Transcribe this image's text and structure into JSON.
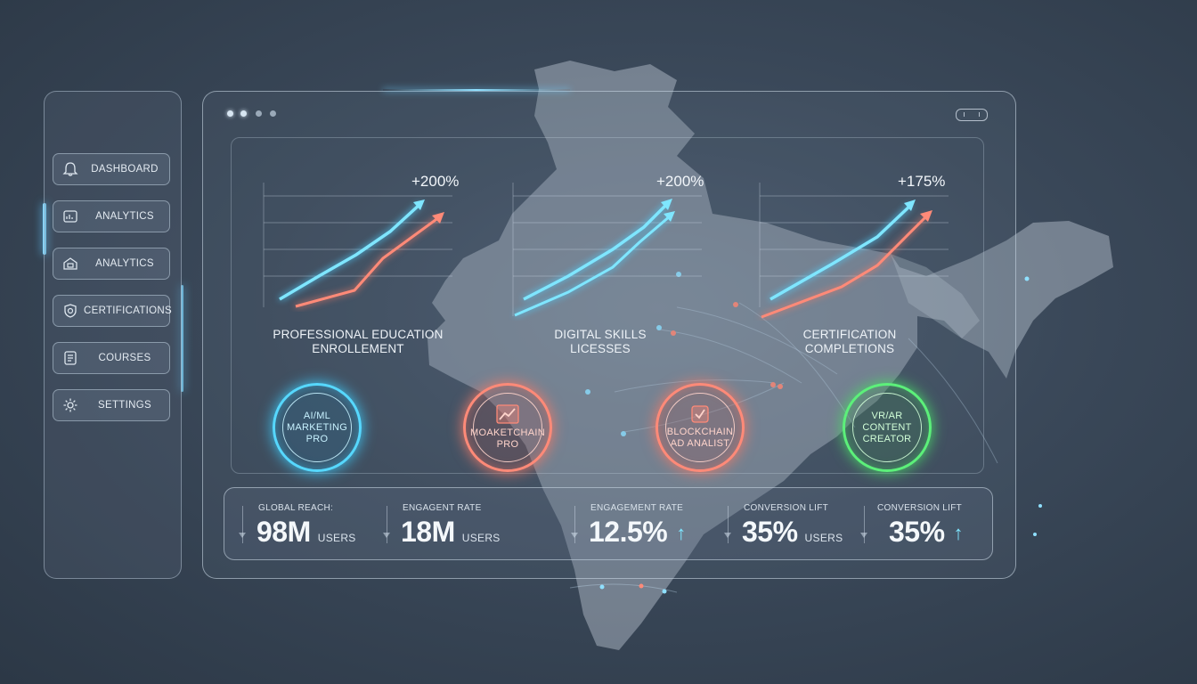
{
  "sidebar": {
    "items": [
      {
        "label": "DASHBOARD",
        "icon": "bell-icon"
      },
      {
        "label": "ANALYTICS",
        "icon": "chart-card-icon"
      },
      {
        "label": "ANALYTICS",
        "icon": "building-icon"
      },
      {
        "label": "CERTIFICATIONS",
        "icon": "shield-icon"
      },
      {
        "label": "COURSES",
        "icon": "book-icon"
      },
      {
        "label": "SETTINGS",
        "icon": "gear-icon"
      }
    ]
  },
  "window": {
    "dots": [
      "#d8e6f2",
      "#d8e6f2",
      "#9aa9b8",
      "#9aa9b8"
    ]
  },
  "charts": [
    {
      "growth": "+200%",
      "title_line1": "PROFESSIONAL EDUCATION",
      "title_line2": "ENROLLEMENT"
    },
    {
      "growth": "+200%",
      "title_line1": "DIGITAL SKILLS",
      "title_line2": "LICESSES"
    },
    {
      "growth": "+175%",
      "title_line1": "CERTIFICATION",
      "title_line2": "COMPLETIONS"
    }
  ],
  "badges": [
    {
      "line1": "AI/ML",
      "line2": "MARKETING",
      "line3": "PRO",
      "color": "cyan",
      "icon": ""
    },
    {
      "line1": "MOAKETCHAIN",
      "line2": "PRO",
      "line3": "",
      "color": "coral",
      "icon": "growth-chart-icon"
    },
    {
      "line1": "BLOCKCHAIN",
      "line2": "AD ANALIST",
      "line3": "",
      "color": "coral",
      "icon": "checkbox-icon"
    },
    {
      "line1": "VR/AR",
      "line2": "CONTENT",
      "line3": "CREATOR",
      "color": "green",
      "icon": ""
    }
  ],
  "stats": [
    {
      "label": "GLOBAL REACH:",
      "value": "98M",
      "unit": "USERS",
      "up": ""
    },
    {
      "label": "ENGAGENT RATE",
      "value": "18M",
      "unit": "USERS",
      "up": ""
    },
    {
      "label": "ENGAGEMENT RATE",
      "value": "12.5%",
      "unit": "",
      "up": "↑"
    },
    {
      "label": "CONVERSION LIFT",
      "value": "35%",
      "unit": "USERS",
      "up": ""
    },
    {
      "label": "CONVERSION LIFT",
      "value": "35%",
      "unit": "",
      "up": "↑"
    }
  ],
  "colors": {
    "accent_cyan": "#56d8ff",
    "accent_coral": "#ff8a78",
    "accent_green": "#5cf07a"
  }
}
